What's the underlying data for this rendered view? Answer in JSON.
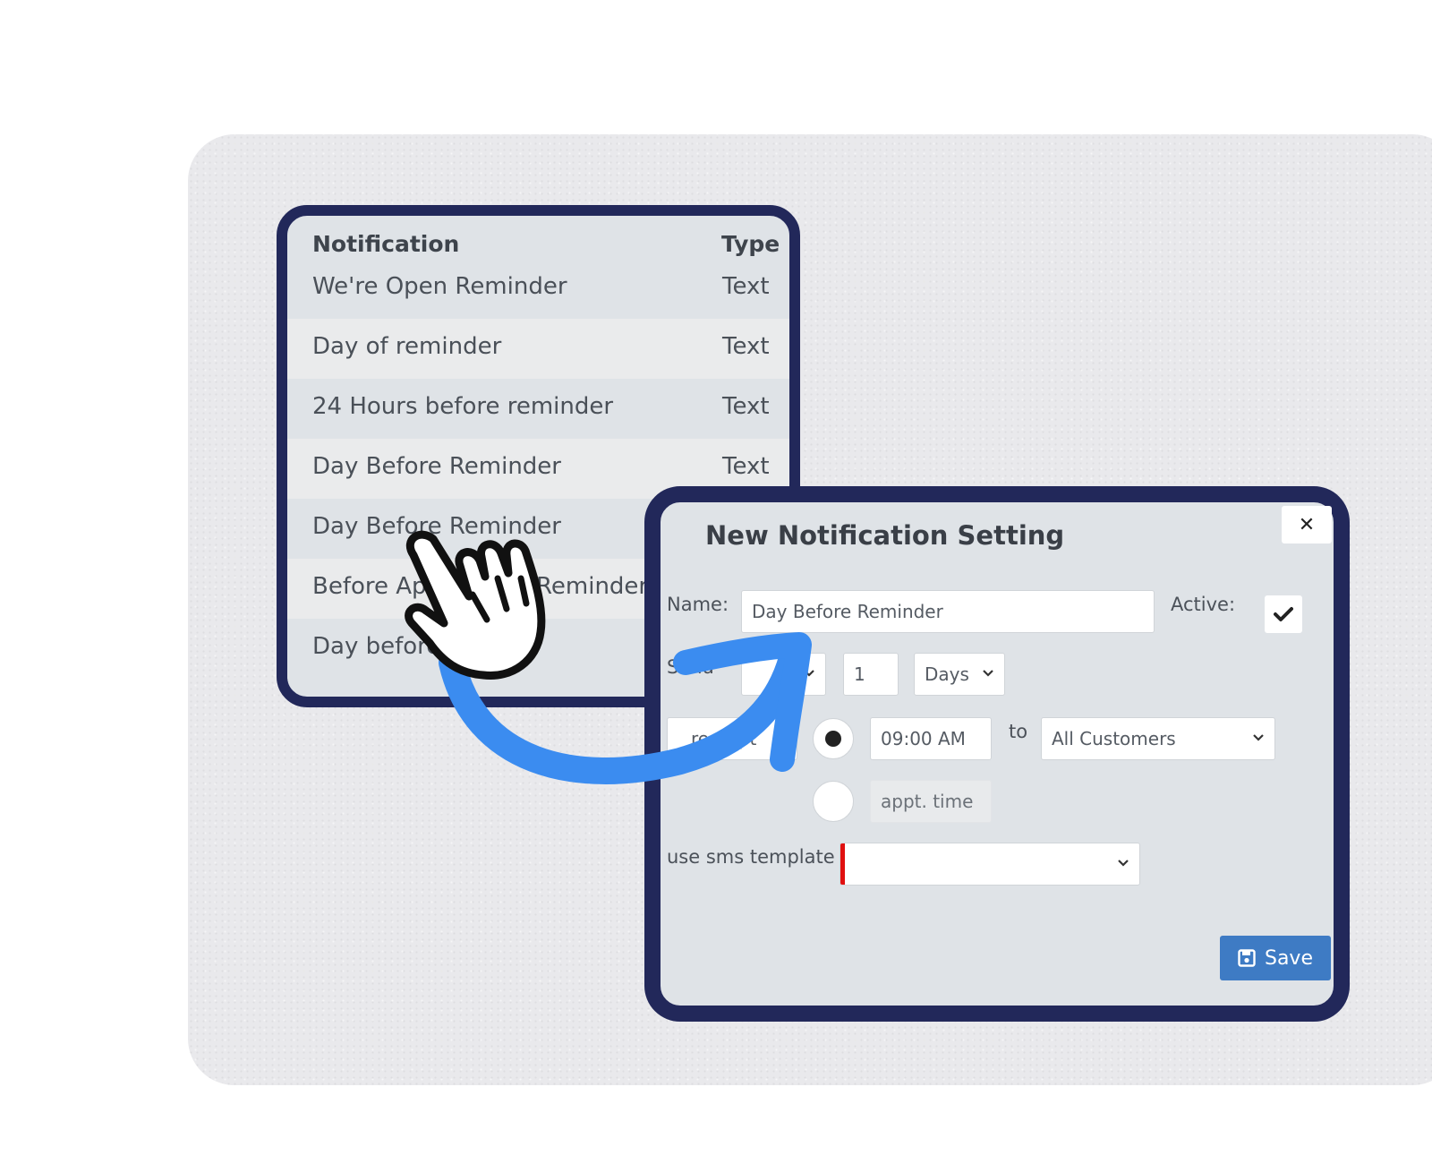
{
  "colors": {
    "card_border": "#22285a",
    "panel_bg": "#dfe3e7",
    "row_alt_bg": "#eaebec",
    "accent_blue": "#3e7bc4",
    "arrow_blue": "#3b8cf0",
    "required_red": "#e01010"
  },
  "list": {
    "header": {
      "notification": "Notification",
      "type": "Type"
    },
    "rows": [
      {
        "name": "We're Open Reminder",
        "type": "Text"
      },
      {
        "name": "Day of reminder",
        "type": "Text"
      },
      {
        "name": "24 Hours before reminder",
        "type": "Text"
      },
      {
        "name": "Day Before Reminder",
        "type": "Text"
      },
      {
        "name": "Day Before Reminder",
        "type": ""
      },
      {
        "name": "Before Ap",
        "name_tail": "Reminder",
        "type": ""
      },
      {
        "name": "Day before",
        "type": ""
      }
    ]
  },
  "dialog": {
    "title": "New Notification Setting",
    "close_icon": "close-icon",
    "name_label": "Name:",
    "name_value": "Day Before Reminder",
    "active_label": "Active:",
    "active_checked": true,
    "send_label": "Send",
    "send_count": "1",
    "send_unit": "Days",
    "relative_partial": "re Appt",
    "time_value": "09:00 AM",
    "to_label": "to",
    "recipients": "All Customers",
    "appt_time_placeholder": "appt. time",
    "template_label": "use sms template",
    "template_value": "",
    "save_label": "Save",
    "save_icon": "floppy-disk-icon"
  },
  "overlays": {
    "pointer": "hand-pointer-icon",
    "arrow": "curved-arrow-icon"
  }
}
